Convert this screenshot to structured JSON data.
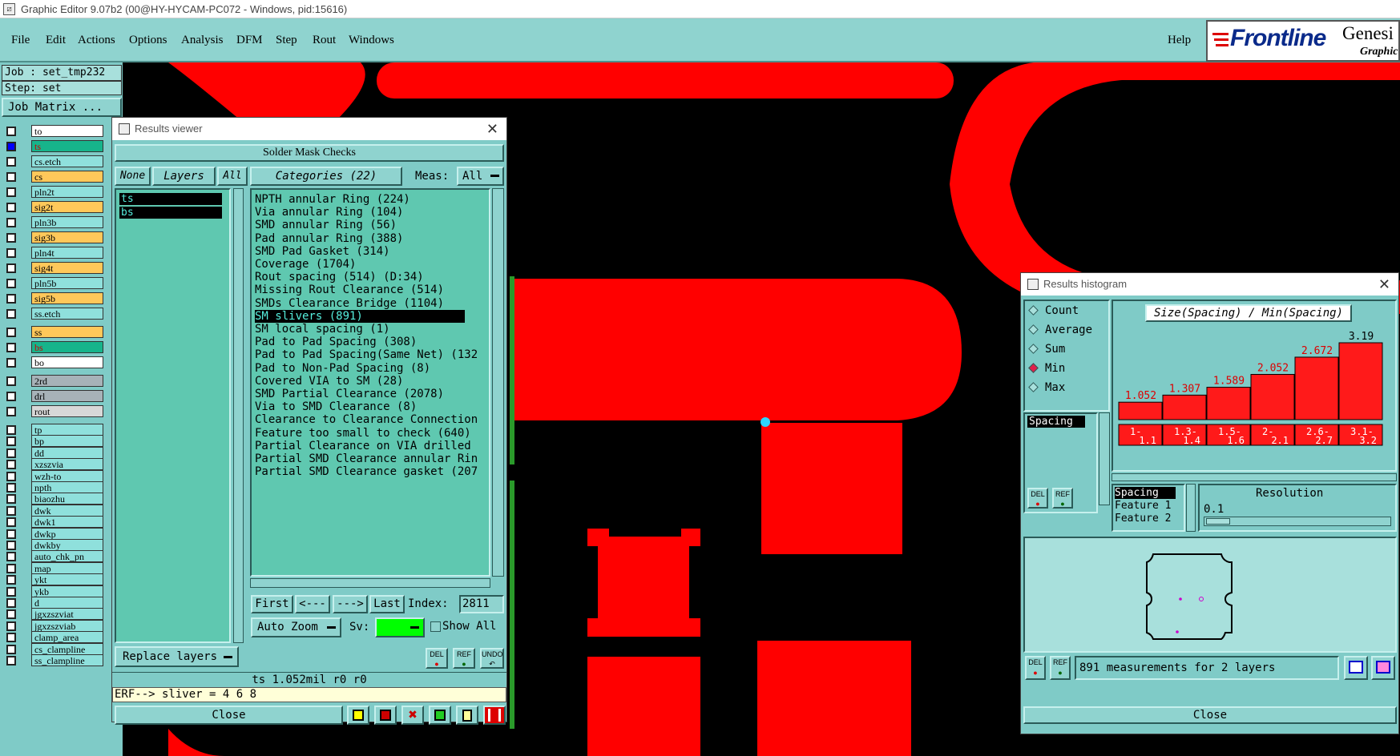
{
  "titlebar": {
    "text": "Graphic Editor 9.07b2 (00@HY-HYCAM-PC072 - Windows, pid:15616)"
  },
  "menu": {
    "file": "File",
    "edit": "Edit",
    "actions": "Actions",
    "options": "Options",
    "analysis": "Analysis",
    "dfm": "DFM",
    "step": "Step",
    "rout": "Rout",
    "windows": "Windows",
    "help": "Help"
  },
  "logo": {
    "brand": "Frontline",
    "product": "Genesi",
    "sub": "Graphic"
  },
  "job": {
    "job": "Job : set_tmp232",
    "step": "Step: set",
    "matrix": "Job Matrix ..."
  },
  "layers": [
    {
      "name": "to",
      "color": "white",
      "checked": false
    },
    {
      "name": "ts",
      "color": "green",
      "checked": true
    },
    {
      "name": "cs.etch",
      "color": "cyan",
      "checked": false
    },
    {
      "name": "cs",
      "color": "orange",
      "checked": false
    },
    {
      "name": "pln2t",
      "color": "cyan",
      "checked": false
    },
    {
      "name": "sig2t",
      "color": "orange",
      "checked": false
    },
    {
      "name": "pln3b",
      "color": "cyan",
      "checked": false
    },
    {
      "name": "sig3b",
      "color": "orange",
      "checked": false
    },
    {
      "name": "pln4t",
      "color": "cyan",
      "checked": false
    },
    {
      "name": "sig4t",
      "color": "orange",
      "checked": false
    },
    {
      "name": "pln5b",
      "color": "cyan",
      "checked": false
    },
    {
      "name": "sig5b",
      "color": "orange",
      "checked": false
    },
    {
      "name": "ss.etch",
      "color": "cyan",
      "checked": false
    },
    {
      "name": "ss",
      "color": "orange",
      "checked": false
    },
    {
      "name": "bs",
      "color": "green",
      "checked": false
    },
    {
      "name": "bo",
      "color": "white",
      "checked": false
    },
    {
      "name": "2rd",
      "color": "gray",
      "checked": false
    },
    {
      "name": "drl",
      "color": "gray",
      "checked": false
    },
    {
      "name": "rout",
      "color": "lgray",
      "checked": false
    },
    {
      "name": "tp",
      "color": "cyan",
      "checked": false
    },
    {
      "name": "bp",
      "color": "cyan",
      "checked": false
    },
    {
      "name": "dd",
      "color": "cyan",
      "checked": false
    },
    {
      "name": "xzszvia",
      "color": "cyan",
      "checked": false
    },
    {
      "name": "wzh-to",
      "color": "cyan",
      "checked": false
    },
    {
      "name": "npth",
      "color": "cyan",
      "checked": false
    },
    {
      "name": "biaozhu",
      "color": "cyan",
      "checked": false
    },
    {
      "name": "dwk",
      "color": "cyan",
      "checked": false
    },
    {
      "name": "dwk1",
      "color": "cyan",
      "checked": false
    },
    {
      "name": "dwkp",
      "color": "cyan",
      "checked": false
    },
    {
      "name": "dwkby",
      "color": "cyan",
      "checked": false
    },
    {
      "name": "auto_chk_pn",
      "color": "cyan",
      "checked": false
    },
    {
      "name": "map",
      "color": "cyan",
      "checked": false
    },
    {
      "name": "ykt",
      "color": "cyan",
      "checked": false
    },
    {
      "name": "ykb",
      "color": "cyan",
      "checked": false
    },
    {
      "name": "d",
      "color": "cyan",
      "checked": false
    },
    {
      "name": "jgxzszviat",
      "color": "cyan",
      "checked": false
    },
    {
      "name": "jgxzszviab",
      "color": "cyan",
      "checked": false
    },
    {
      "name": "clamp_area",
      "color": "cyan",
      "checked": false
    },
    {
      "name": "cs_clampline",
      "color": "cyan",
      "checked": false
    },
    {
      "name": "ss_clampline",
      "color": "cyan",
      "checked": false
    }
  ],
  "results_viewer": {
    "title": "Results viewer",
    "header": "Solder Mask Checks",
    "none_btn": "None",
    "layers_btn": "Layers",
    "all_btn": "All",
    "categories_btn": "Categories (22)",
    "meas_label": "Meas:",
    "meas_value": "All",
    "layer_list": [
      "ts",
      "bs"
    ],
    "categories": [
      "NPTH annular Ring (224)",
      "Via annular Ring (104)",
      "SMD annular Ring (56)",
      "Pad annular Ring (388)",
      "SMD Pad Gasket (314)",
      "Coverage (1704)",
      "Rout spacing (514)         (D:34)",
      "Missing Rout Clearance (514)",
      "SMDs Clearance Bridge (1104)",
      "SM slivers (891)",
      "SM local spacing (1)",
      "Pad to Pad Spacing (308)",
      "Pad to Pad Spacing(Same Net) (132",
      "Pad to Non-Pad Spacing (8)",
      "Covered VIA to SM (28)",
      "SMD Partial Clearance (2078)",
      "Via to SMD Clearance (8)",
      "Clearance to Clearance Connection",
      "Feature too small to check (640)",
      "Partial Clearance on VIA drilled",
      "Partial SMD Clearance annular Rin",
      "Partial SMD Clearance gasket (207"
    ],
    "selected_index": 9,
    "first_btn": "First",
    "prev_btn": "<---",
    "next_btn": "--->",
    "last_btn": "Last",
    "index_label": "Index:",
    "index_value": "2811",
    "autozoom": "Auto Zoom",
    "sv_label": "Sv:",
    "show_all": "Show All",
    "replace_layers": "Replace layers",
    "del": "DEL",
    "ref": "REF",
    "undo": "UNDO",
    "status": "ts 1.052mil  r0  r0",
    "erf": "ERF--> sliver = 4 6 8",
    "close": "Close"
  },
  "histogram": {
    "title": "Results histogram",
    "modes": [
      {
        "label": "Count",
        "selected": false
      },
      {
        "label": "Average",
        "selected": false
      },
      {
        "label": "Sum",
        "selected": false
      },
      {
        "label": "Min",
        "selected": true
      },
      {
        "label": "Max",
        "selected": false
      }
    ],
    "attr_list": [
      "Spacing"
    ],
    "chart_title": "Size(Spacing) / Min(Spacing)",
    "resolution_label": "Resolution",
    "resolution_value": "0.1",
    "fields": [
      "Spacing",
      "Feature 1",
      "Feature 2"
    ],
    "summary": "891 measurements for 2 layers",
    "close": "Close",
    "del": "DEL",
    "ref": "REF"
  },
  "chart_data": {
    "type": "bar",
    "title": "Size(Spacing) / Min(Spacing)",
    "categories": [
      [
        "1-",
        "1.1"
      ],
      [
        "1.3-",
        "1.4"
      ],
      [
        "1.5-",
        "1.6"
      ],
      [
        "2-",
        "2.1"
      ],
      [
        "2.6-",
        "2.7"
      ],
      [
        "3.1-",
        "3.2"
      ]
    ],
    "values": [
      1.052,
      1.307,
      1.589,
      2.052,
      2.672,
      3.19
    ],
    "value_labels": [
      "1.052",
      "1.307",
      "1.589",
      "2.052",
      "2.672",
      "3.19"
    ],
    "bar_color": "#ff1a1a"
  },
  "colors": {
    "panel": "#7fcbc7",
    "list": "#4ec9a8",
    "artwork": "#ff0000",
    "canvas": "#000000"
  }
}
